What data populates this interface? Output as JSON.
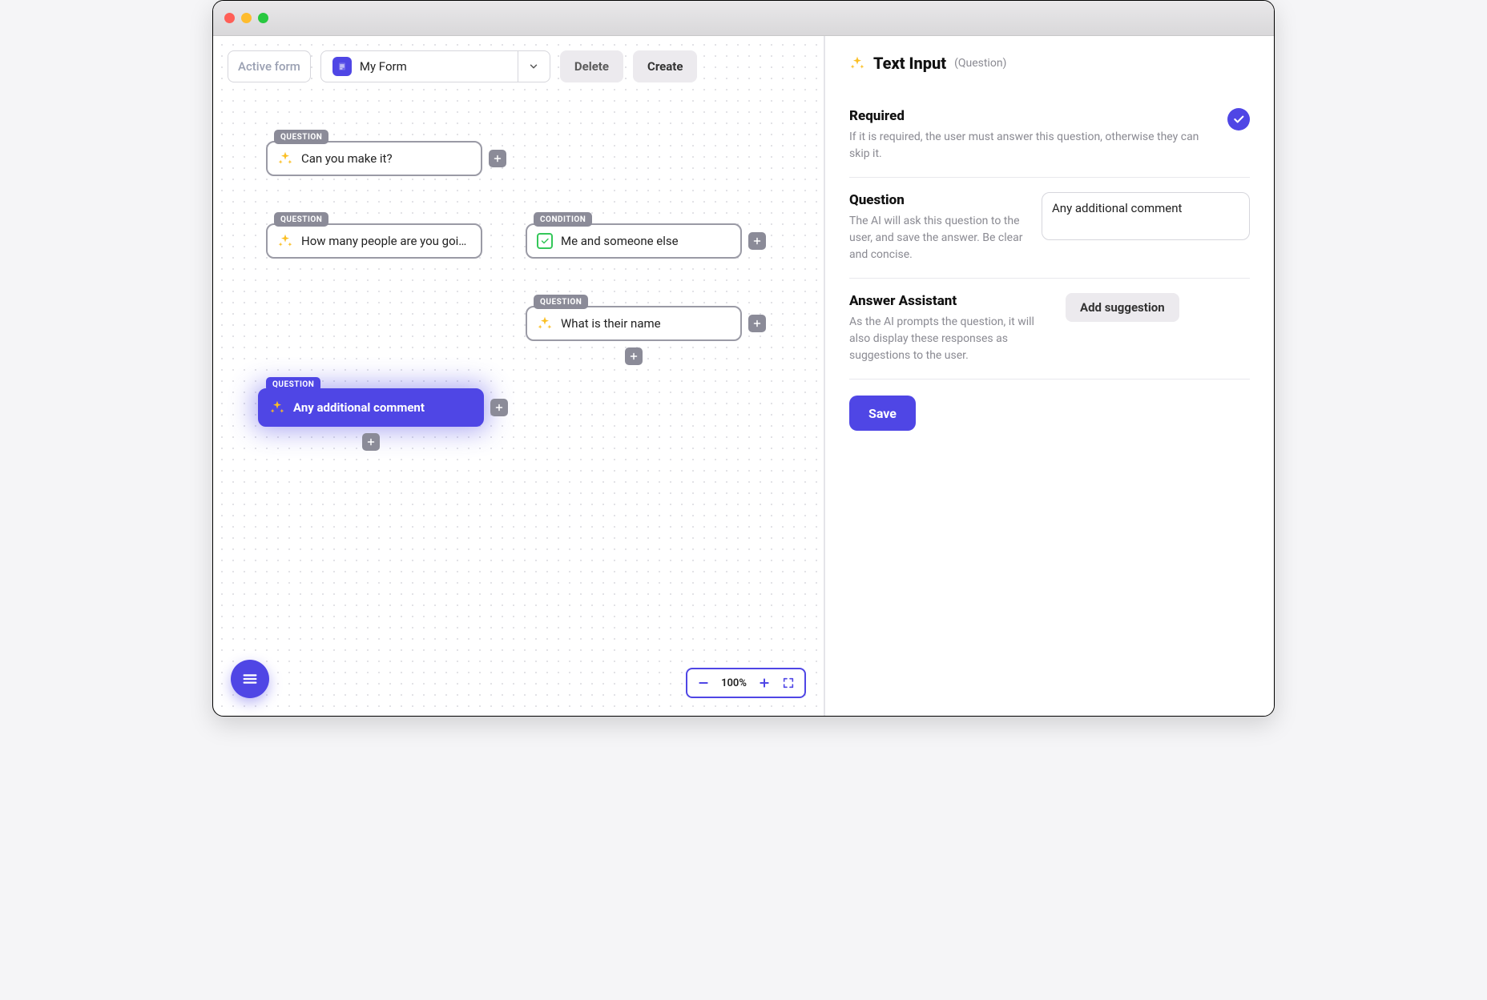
{
  "toolbar": {
    "active_form_label": "Active form",
    "form_name": "My Form",
    "delete_label": "Delete",
    "create_label": "Create"
  },
  "zoom": {
    "level": "100%"
  },
  "tags": {
    "question": "QUESTION",
    "condition": "CONDITION"
  },
  "nodes": {
    "n1": "Can you make it?",
    "n2": "How many people are you going …",
    "n3": "Me and someone else",
    "n4": "What is their name",
    "n5": "Any additional comment"
  },
  "sidepanel": {
    "title": "Text Input",
    "title_sub": "(Question)",
    "required": {
      "label": "Required",
      "desc": "If it is required, the user must answer this question, otherwise they can skip it."
    },
    "question": {
      "label": "Question",
      "desc": "The AI will ask this question to the user, and save the answer. Be clear and concise.",
      "value": "Any additional comment"
    },
    "assistant": {
      "label": "Answer Assistant",
      "desc": "As the AI prompts the question, it will also display these responses as suggestions to the user.",
      "add_label": "Add suggestion"
    },
    "save_label": "Save"
  }
}
